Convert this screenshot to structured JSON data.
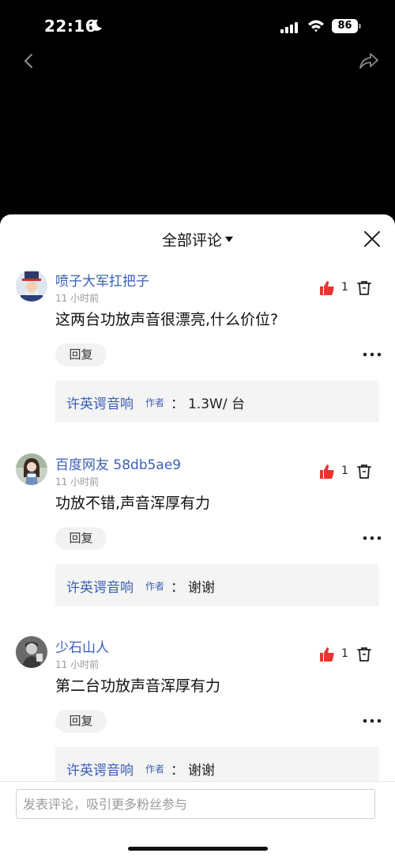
{
  "status_bar": {
    "time": "22:16",
    "battery": "86"
  },
  "header": {
    "title": "全部评论",
    "dropdown_icon": "triangle-down-icon"
  },
  "comments": [
    {
      "username": "喷子大军扛把子",
      "time": "11 小时前",
      "likes": "1",
      "content": "这两台功放声音很漂亮,什么价位?",
      "reply_label": "回复",
      "author_reply": {
        "name": "许英谔音响",
        "tag": "作者",
        "colon": "：",
        "text": "1.3W/ 台"
      }
    },
    {
      "username": "百度网友 58db5ae9",
      "time": "11 小时前",
      "likes": "1",
      "content": "功放不错,声音浑厚有力",
      "reply_label": "回复",
      "author_reply": {
        "name": "许英谔音响",
        "tag": "作者",
        "colon": "：",
        "text": "谢谢"
      }
    },
    {
      "username": "少石山人",
      "time": "11 小时前",
      "likes": "1",
      "content": "第二台功放声音浑厚有力",
      "reply_label": "回复",
      "author_reply": {
        "name": "许英谔音响",
        "tag": "作者",
        "colon": "：",
        "text": "谢谢"
      }
    }
  ],
  "input": {
    "placeholder": "发表评论，吸引更多粉丝参与"
  },
  "colors": {
    "link_blue": "#3a5fb7",
    "like_red": "#e8352e",
    "sheet_bg": "#ffffff",
    "reply_bg": "#f4f4f4"
  }
}
